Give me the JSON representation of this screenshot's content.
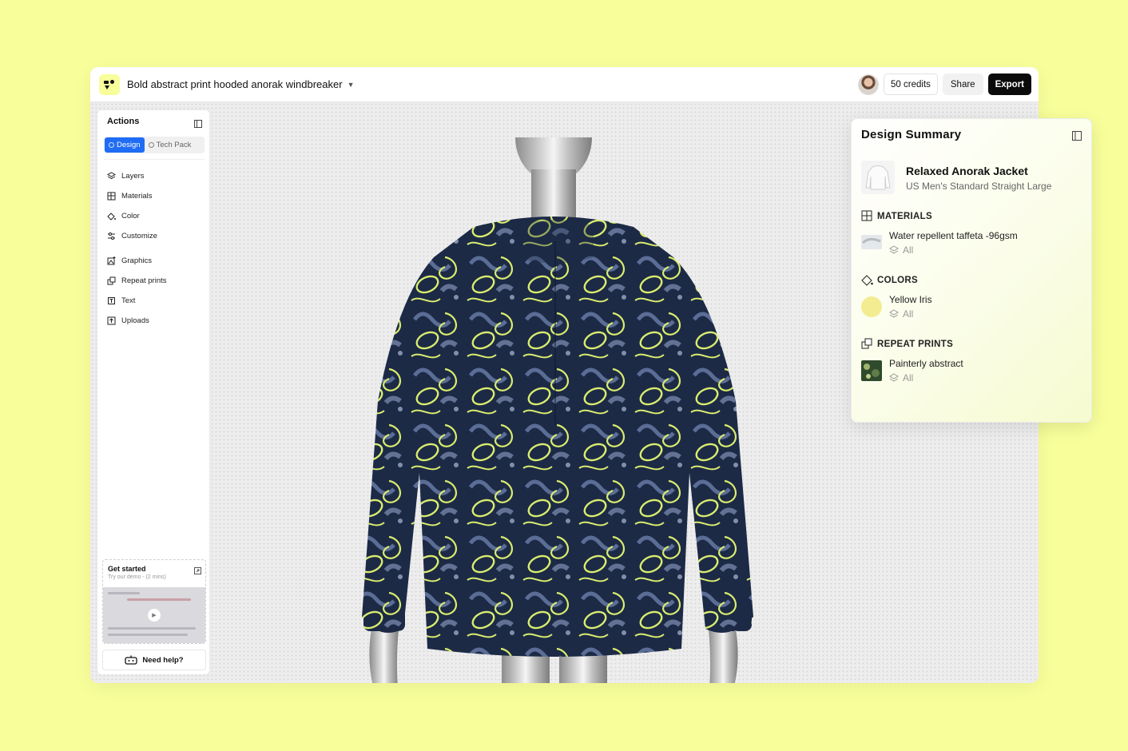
{
  "header": {
    "title": "Bold abstract print hooded anorak windbreaker",
    "credits": "50 credits",
    "share_label": "Share",
    "export_label": "Export"
  },
  "sidebar": {
    "heading": "Actions",
    "tabs": [
      {
        "label": "Design",
        "active": true
      },
      {
        "label": "Tech Pack",
        "active": false
      }
    ],
    "items": [
      {
        "label": "Layers",
        "icon": "layers-icon"
      },
      {
        "label": "Materials",
        "icon": "materials-icon"
      },
      {
        "label": "Color",
        "icon": "paint-bucket-icon"
      },
      {
        "label": "Customize",
        "icon": "sliders-icon"
      },
      {
        "label": "Graphics",
        "icon": "graphics-icon"
      },
      {
        "label": "Repeat prints",
        "icon": "repeat-prints-icon"
      },
      {
        "label": "Text",
        "icon": "text-frame-icon"
      },
      {
        "label": "Uploads",
        "icon": "upload-icon"
      }
    ],
    "get_started": {
      "title": "Get started",
      "subtitle": "Try our demo - (2 mins)"
    },
    "help_label": "Need help?"
  },
  "summary": {
    "title": "Design Summary",
    "product": {
      "name": "Relaxed Anorak Jacket",
      "subtitle": "US Men's Standard Straight Large"
    },
    "sections": {
      "materials": {
        "heading": "MATERIALS",
        "item": "Water repellent taffeta -96gsm",
        "scope": "All"
      },
      "colors": {
        "heading": "COLORS",
        "item": "Yellow Iris",
        "scope": "All",
        "swatch": "#f3ec91"
      },
      "prints": {
        "heading": "REPEAT PRINTS",
        "item": "Painterly abstract",
        "scope": "All"
      }
    }
  },
  "colors": {
    "background": "#f7fe9a",
    "accent": "#1f6cf5",
    "print_navy": "#1b2a44",
    "print_yellow": "#d9ec6e"
  }
}
